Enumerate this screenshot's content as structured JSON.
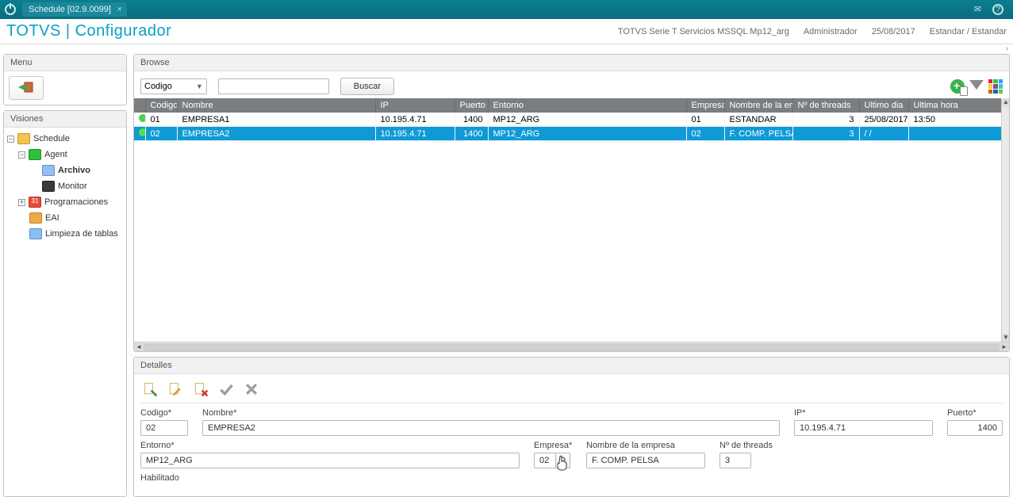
{
  "titlebar": {
    "tab_label": "Schedule [02.9.0099]"
  },
  "header": {
    "brand": "TOTVS | Configurador",
    "env": "TOTVS Serie T Servicios MSSQL Mp12_arg",
    "user": "Administrador",
    "date": "25/08/2017",
    "profile": "Estandar / Estandar"
  },
  "sidebar": {
    "menu_title": "Menu",
    "visions_title": "Visiones",
    "tree": {
      "schedule": "Schedule",
      "agent": "Agent",
      "archivo": "Archivo",
      "monitor": "Monitor",
      "programaciones": "Programaciones",
      "eai": "EAI",
      "limpieza": "Limpieza de tablas"
    }
  },
  "browse": {
    "title": "Browse",
    "search_field": "Codigo",
    "search_value": "",
    "buscar": "Buscar",
    "columns": {
      "codigo": "Codigo",
      "nombre": "Nombre",
      "ip": "IP",
      "puerto": "Puerto",
      "entorno": "Entorno",
      "empresa": "Empresa",
      "nombre_empresa": "Nombre de la empr",
      "threads": "Nº de threads",
      "ultimo_dia": "Ultimo dia",
      "ultima_hora": "Ultima hora"
    },
    "rows": [
      {
        "codigo": "01",
        "nombre": "EMPRESA1",
        "ip": "10.195.4.71",
        "puerto": "1400",
        "entorno": "MP12_ARG",
        "empresa": "01",
        "nombre_empresa": "ESTANDAR",
        "threads": "3",
        "ultimo_dia": "25/08/2017",
        "ultima_hora": "13:50"
      },
      {
        "codigo": "02",
        "nombre": "EMPRESA2",
        "ip": "10.195.4.71",
        "puerto": "1400",
        "entorno": "MP12_ARG",
        "empresa": "02",
        "nombre_empresa": "F. COMP. PELSA",
        "threads": "3",
        "ultimo_dia": "  /  /",
        "ultima_hora": ""
      }
    ]
  },
  "detalles": {
    "title": "Detalles",
    "labels": {
      "codigo": "Codigo*",
      "nombre": "Nombre*",
      "ip": "IP*",
      "puerto": "Puerto*",
      "entorno": "Entorno*",
      "empresa": "Empresa*",
      "nombre_empresa": "Nombre de la empresa",
      "threads": "Nº de threads",
      "habilitado": "Habilitado"
    },
    "values": {
      "codigo": "02",
      "nombre": "EMPRESA2",
      "ip": "10.195.4.71",
      "puerto": "1400",
      "entorno": "MP12_ARG",
      "empresa": "02",
      "nombre_empresa": "F. COMP. PELSA",
      "threads": "3"
    }
  }
}
